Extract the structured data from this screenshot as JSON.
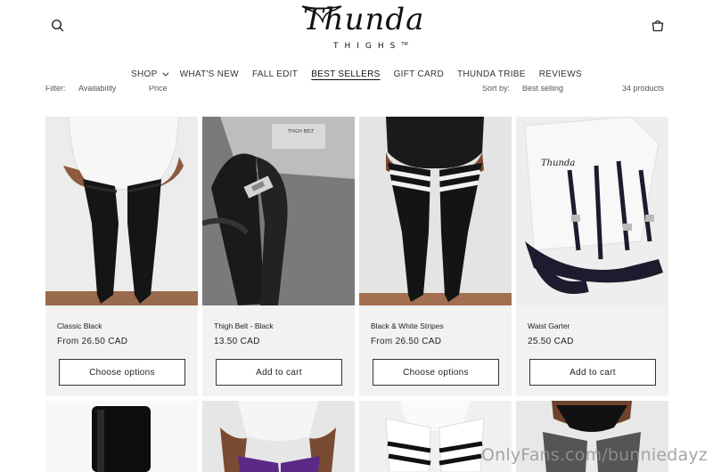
{
  "header": {
    "logo_script": "Thunda",
    "logo_sub": "THIGHS",
    "logo_tm": "TM",
    "search_icon": "search-icon",
    "cart_icon": "cart-icon"
  },
  "nav": {
    "items": [
      {
        "label": "SHOP",
        "dropdown": true
      },
      {
        "label": "WHAT'S NEW"
      },
      {
        "label": "FALL EDIT"
      },
      {
        "label": "BEST SELLERS",
        "active": true
      },
      {
        "label": "GIFT CARD"
      },
      {
        "label": "THUNDA TRIBE"
      },
      {
        "label": "REVIEWS"
      }
    ]
  },
  "filterbar": {
    "filter_label": "Filter:",
    "availability": "Availability",
    "price": "Price",
    "sort_label": "Sort by:",
    "sort_value": "Best selling",
    "count": "34 products"
  },
  "products": [
    {
      "title": "Classic Black",
      "price": "From 26.50 CAD",
      "button": "Choose options"
    },
    {
      "title": "Thigh Belt - Black",
      "price": "13.50 CAD",
      "button": "Add to cart"
    },
    {
      "title": "Black & White Stripes",
      "price": "From 26.50 CAD",
      "button": "Choose options"
    },
    {
      "title": "Waist Garter",
      "price": "25.50 CAD",
      "button": "Add to cart"
    }
  ],
  "packaging_text": {
    "belt_box": "THIGH BELT",
    "garter_box": "Thunda"
  },
  "watermark": "OnlyFans.com/bunniedayz",
  "colors": {
    "card_bg": "#f2f2f2",
    "text": "#121212",
    "button_border": "#333333"
  }
}
